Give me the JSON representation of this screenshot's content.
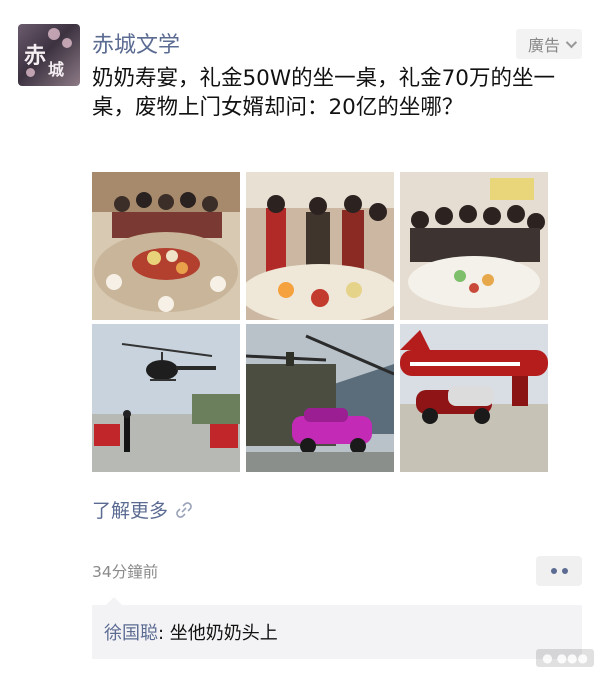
{
  "account": {
    "name": "赤城文学",
    "avatar_text": "赤城"
  },
  "ad": {
    "label": "廣告"
  },
  "post": {
    "text": "奶奶寿宴，礼金50W的坐一桌，礼金70万的坐一桌，废物上门女婿却问：20亿的坐哪？",
    "images": [
      {
        "icon": "banquet-photo"
      },
      {
        "icon": "banquet-toast-photo"
      },
      {
        "icon": "banquet-group-photo"
      },
      {
        "icon": "helicopter-cars-photo"
      },
      {
        "icon": "chinook-sportscar-photo"
      },
      {
        "icon": "jet-bugatti-photo"
      }
    ],
    "read_more": "了解更多",
    "timestamp": "34分鐘前"
  },
  "comment": {
    "author": "徐国聪",
    "separator": ": ",
    "text": "坐他奶奶头上"
  },
  "colors": {
    "link": "#5b6b92",
    "meta": "#8a8a8a",
    "comment_bg": "#f3f3f5"
  }
}
